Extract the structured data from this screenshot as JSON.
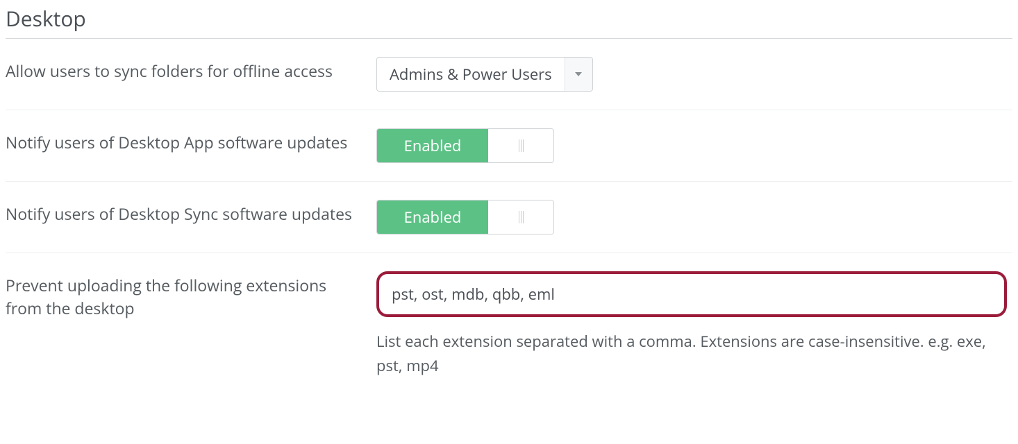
{
  "section": {
    "heading": "Desktop"
  },
  "settings": {
    "sync_folders": {
      "label": "Allow users to sync folders for offline access",
      "selected": "Admins & Power Users"
    },
    "notify_app_updates": {
      "label": "Notify users of Desktop App software updates",
      "state_label": "Enabled"
    },
    "notify_sync_updates": {
      "label": "Notify users of Desktop Sync software updates",
      "state_label": "Enabled"
    },
    "prevent_extensions": {
      "label": "Prevent uploading the following extensions from the desktop",
      "value": "pst, ost, mdb, qbb, eml",
      "help": "List each extension separated with a comma. Extensions are case-insensitive. e.g. exe, pst, mp4"
    }
  }
}
